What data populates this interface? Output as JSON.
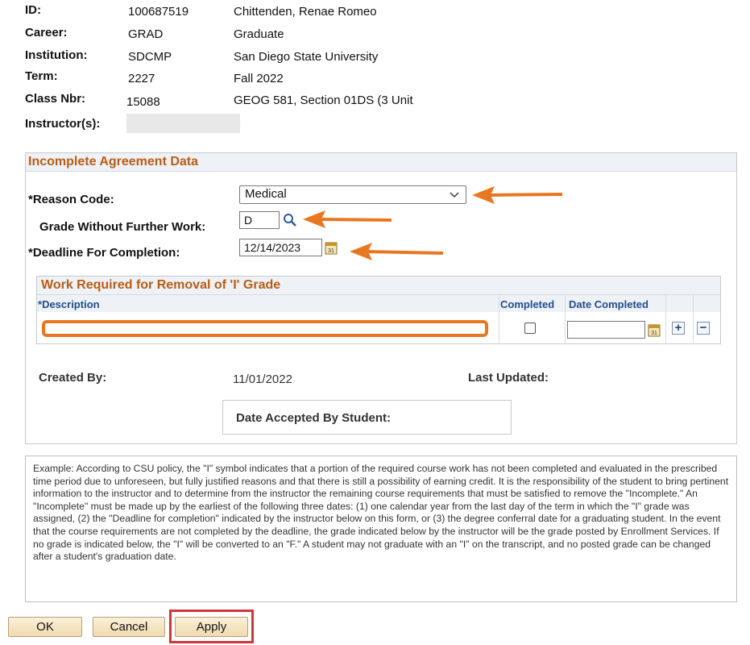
{
  "header": {
    "id_label": "ID:",
    "id_value": "100687519",
    "id_name": "Chittenden, Renae Romeo",
    "career_label": "Career:",
    "career_value": "GRAD",
    "career_desc": "Graduate",
    "institution_label": "Institution:",
    "institution_value": "SDCMP",
    "institution_desc": "San Diego State University",
    "term_label": "Term:",
    "term_value": "2227",
    "term_desc": "Fall 2022",
    "class_label": "Class Nbr:",
    "class_value": "15088",
    "class_desc": "GEOG 581, Section 01DS (3 Unit",
    "instructor_label": "Instructor(s):"
  },
  "agreement": {
    "title": "Incomplete Agreement Data",
    "reason_label": "*Reason Code:",
    "reason_value": "Medical",
    "grade_label": "Grade Without Further Work:",
    "grade_value": "D",
    "deadline_label": "*Deadline For Completion:",
    "deadline_value": "12/14/2023"
  },
  "work": {
    "title": "Work Required for Removal of 'I' Grade",
    "col_description_star": "*",
    "col_description": "Description",
    "col_completed": "Completed",
    "col_date_completed": "Date Completed",
    "description_value": "",
    "date_completed_value": "",
    "add_symbol": "+",
    "remove_symbol": "−"
  },
  "meta": {
    "created_by_label": "Created By:",
    "created_date": "11/01/2022",
    "last_updated_label": "Last Updated:",
    "date_accepted_label": "Date Accepted By Student:"
  },
  "policy_text": "Example: According to CSU policy, the \"I\" symbol indicates that a portion of the required course work has not been completed and evaluated in the prescribed time period due to unforeseen, but fully justified reasons and that there is still a possibility of earning credit. It is the responsibility of the student to bring pertinent information to the instructor and to determine from the instructor the remaining course requirements that must be satisfied to remove the \"Incomplete.\"  An \"Incomplete\" must be made up by the earliest of the following three dates: (1) one calendar year from the last day of the term in which the \"I\" grade was assigned, (2) the \"Deadline for completion\" indicated by the instructor below on this form, or (3) the degree conferral date for a graduating student.  In the event that the course requirements are not completed by the deadline, the grade indicated below by the instructor will be the grade posted by Enrollment Services.  If no grade is indicated below, the \"I\" will be converted to an \"F.\"  A student may not graduate with an \"I\" on the transcript, and no posted grade can be changed after a student's graduation date.",
  "buttons": {
    "ok": "OK",
    "cancel": "Cancel",
    "apply": "Apply"
  },
  "colors": {
    "section_title": "#b85d14",
    "annotation_arrow": "#e87722",
    "annotation_box": "#d0363a",
    "column_header": "#1f4d8a"
  },
  "icons": {
    "lookup": "magnifier-icon",
    "calendar": "calendar-icon",
    "dropdown": "chevron-down-icon"
  }
}
